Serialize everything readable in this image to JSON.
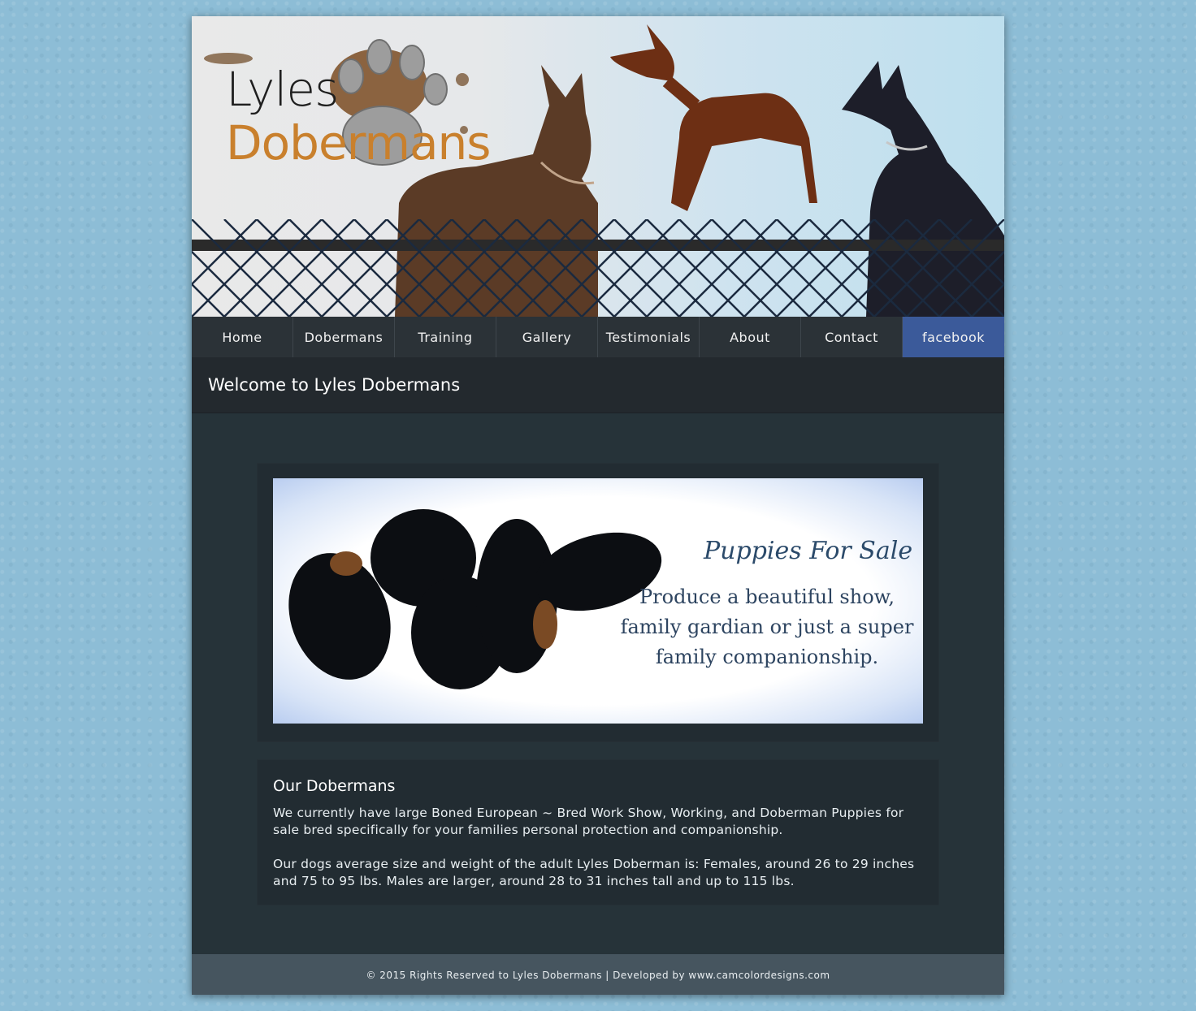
{
  "header": {
    "logo_line1": "Lyles",
    "logo_line2": "Dobermans"
  },
  "nav": {
    "items": [
      "Home",
      "Dobermans",
      "Training",
      "Gallery",
      "Testimonials",
      "About",
      "Contact",
      "facebook"
    ]
  },
  "welcome": {
    "title": "Welcome to Lyles Dobermans"
  },
  "banner": {
    "title": "Puppies For Sale",
    "line1": "Produce a beautiful show,",
    "line2": "family gardian or just a super",
    "line3": "family companionship."
  },
  "about": {
    "heading": "Our Dobermans",
    "para1": "We currently have large Boned European ~ Bred Work Show, Working, and Doberman Puppies for sale bred specifically for your families personal protection and companionship.",
    "para2": "Our dogs average size and weight of the adult Lyles Doberman is: Females, around 26 to 29 inches and 75 to 95 lbs. Males are larger, around 28 to 31 inches tall and up to 115 lbs."
  },
  "footer": {
    "text": "© 2015 Rights Reserved to Lyles Dobermans | Developed by www.camcolordesigns.com"
  },
  "colors": {
    "background": "#8dbdd6",
    "nav_bg": "#2b3237",
    "facebook": "#3b5a9a",
    "logo_orange": "#c9802d"
  }
}
